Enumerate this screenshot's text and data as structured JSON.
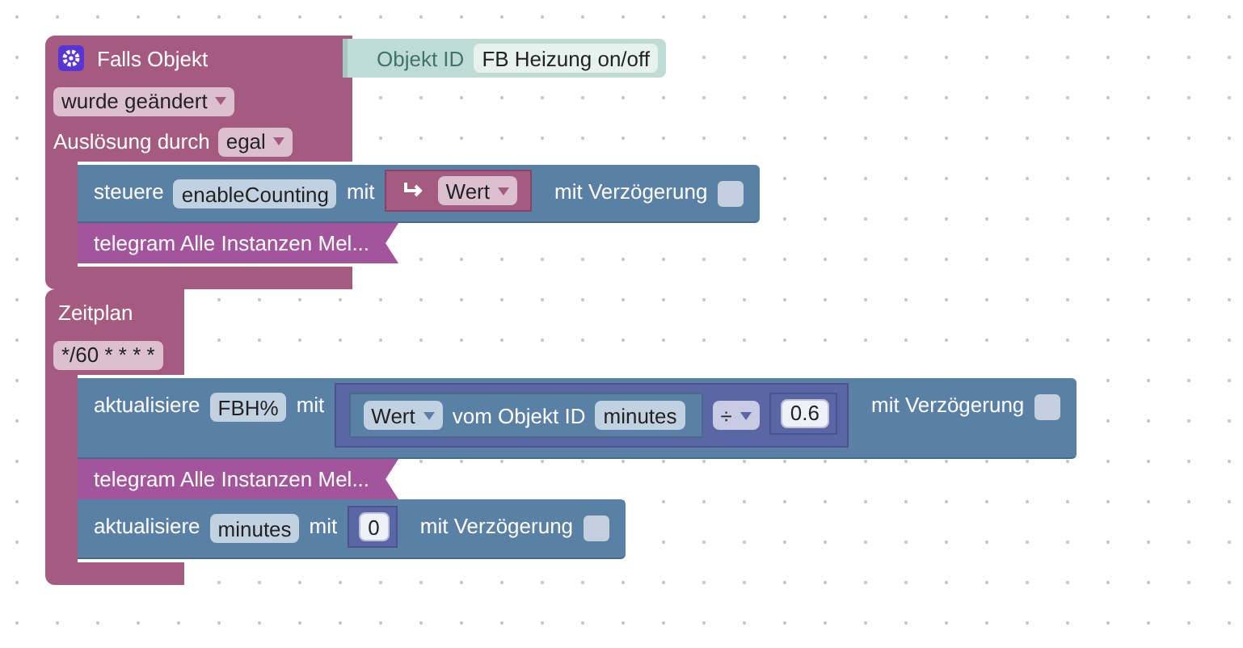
{
  "blocks": [
    {
      "kind": "trigger",
      "title": "Falls Objekt",
      "object": {
        "label": "Objekt ID",
        "value": "FB Heizung on/off"
      },
      "rows": [
        {
          "kind": "dropdown",
          "value": "wurde geändert"
        },
        {
          "kind": "labeled_dropdown",
          "label": "Auslösung durch",
          "value": "egal"
        }
      ],
      "statements": [
        {
          "kind": "control",
          "verb": "steuere",
          "target": "enableCounting",
          "with": "mit",
          "value": {
            "kind": "variable",
            "name": "Wert"
          },
          "delay": {
            "label": "mit Verzögerung",
            "checked": false
          }
        },
        {
          "kind": "telegram",
          "text": "telegram Alle Instanzen Mel..."
        }
      ]
    },
    {
      "kind": "schedule",
      "title": "Zeitplan",
      "rows": [
        {
          "kind": "text_field",
          "value": "*/60 * * * *"
        }
      ],
      "statements": [
        {
          "kind": "control",
          "verb": "aktualisiere",
          "target": "FBH%",
          "with": "mit",
          "value": {
            "kind": "arithmetic",
            "left": {
              "kind": "get_value",
              "attribute": "Wert",
              "label": "vom Objekt ID",
              "object": "minutes"
            },
            "operator": "÷",
            "right": {
              "kind": "number",
              "text": "0.6"
            }
          },
          "delay": {
            "label": "mit Verzögerung",
            "checked": false
          }
        },
        {
          "kind": "telegram",
          "text": "telegram Alle Instanzen Mel..."
        },
        {
          "kind": "control",
          "verb": "aktualisiere",
          "target": "minutes",
          "with": "mit",
          "value": {
            "kind": "number",
            "text": "0"
          },
          "delay": {
            "label": "mit Verzögerung",
            "checked": false
          }
        }
      ]
    }
  ]
}
